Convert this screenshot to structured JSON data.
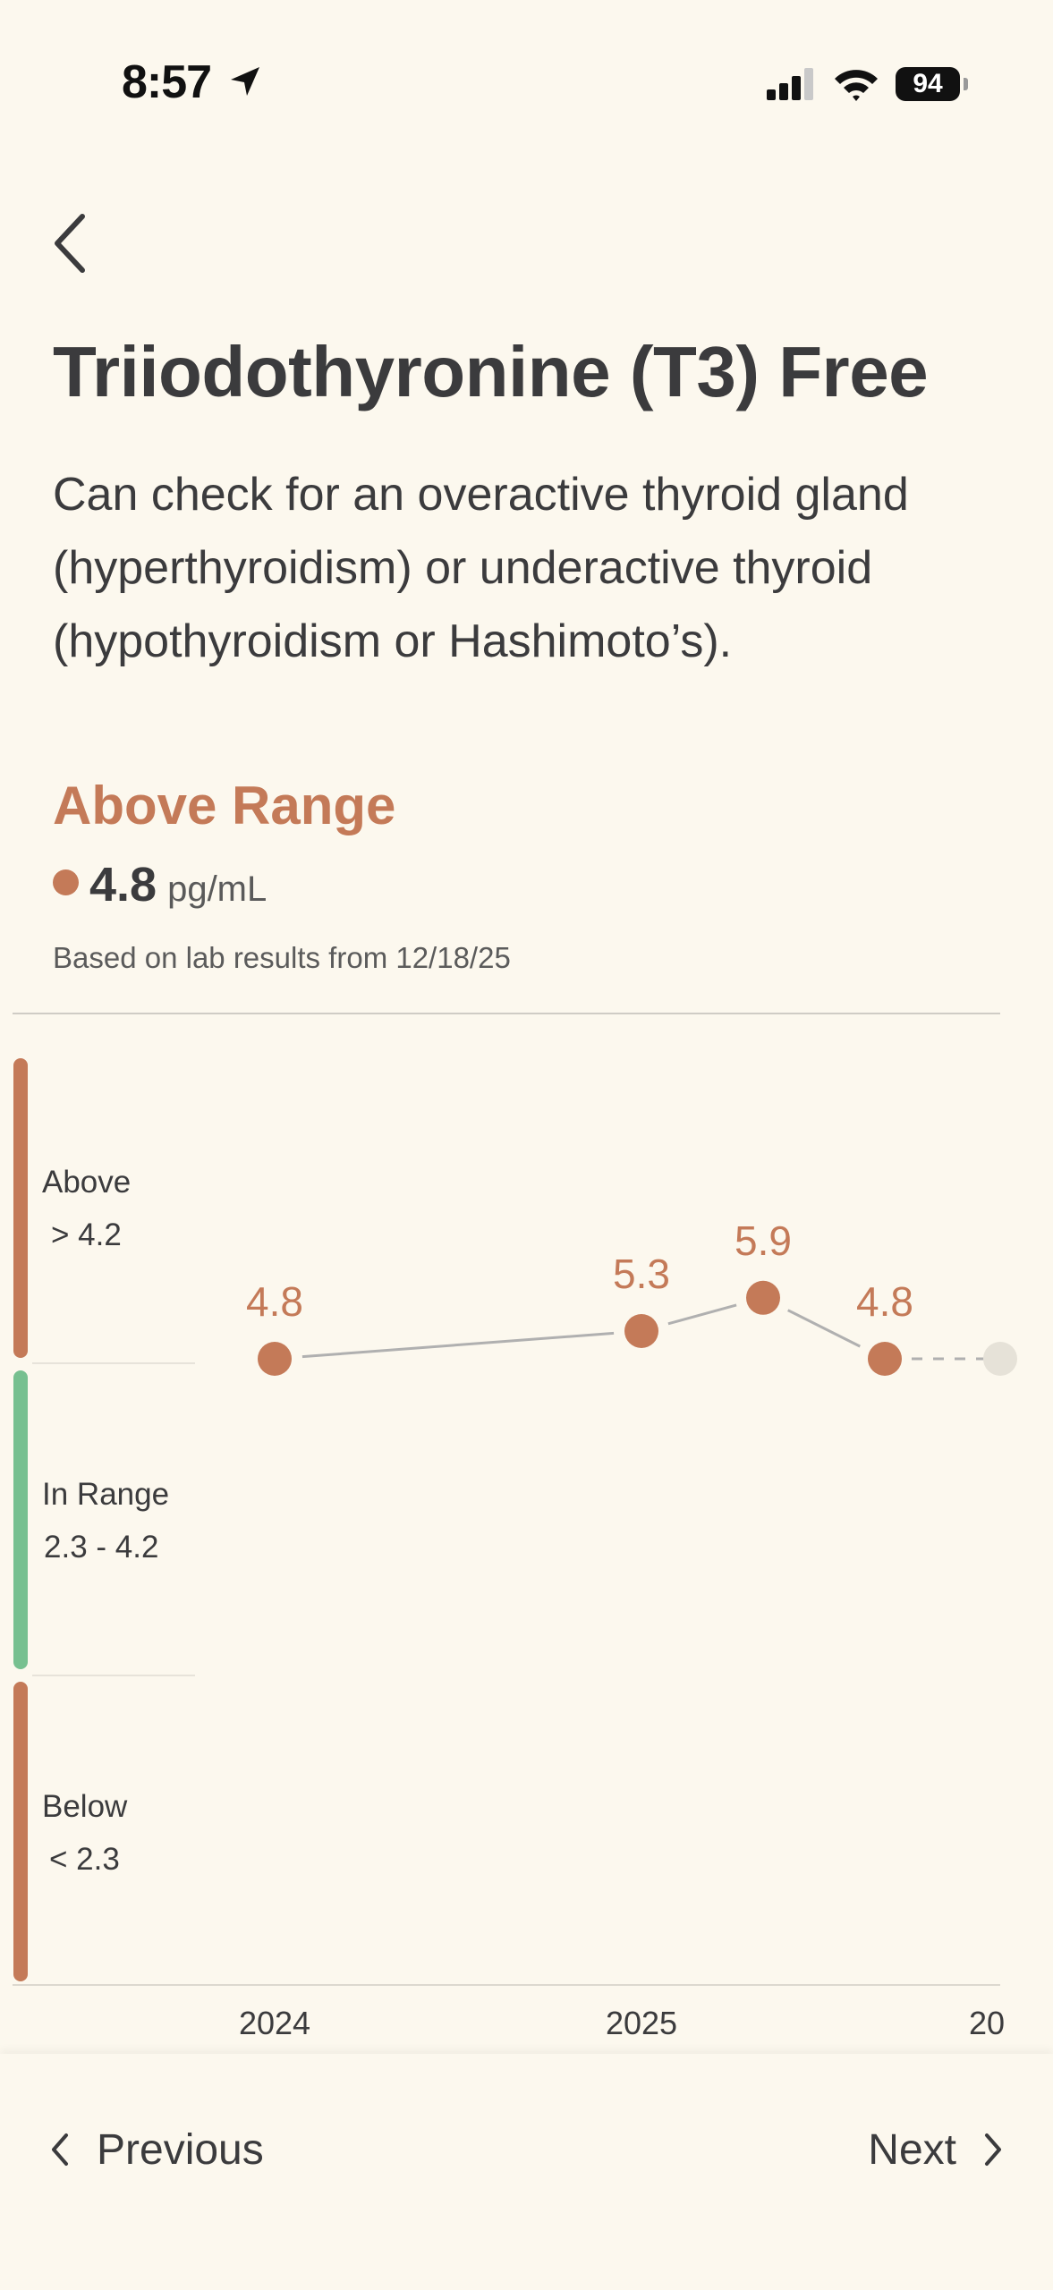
{
  "status_bar": {
    "time": "8:57",
    "battery": "94",
    "icons": [
      "location-arrow-icon",
      "cellular-signal-icon",
      "wifi-icon",
      "battery-icon"
    ]
  },
  "header": {
    "back_icon": "chevron-left-icon",
    "title": "Triiodothyronine (T3) Free",
    "description": "Can check for an overactive thyroid gland (hyperthyroidism) or underactive thyroid (hypothyroidism or Hashimoto’s)."
  },
  "result": {
    "status": "Above Range",
    "value": "4.8",
    "unit": "pg/mL",
    "based_on": "Based on lab results from 12/18/25"
  },
  "colors": {
    "above": "#c47a58",
    "in_range": "#77c090",
    "below": "#c47a58",
    "point": "#c47a58",
    "line": "#b0b0b0",
    "background": "#fcf8ee"
  },
  "chart_data": {
    "type": "line",
    "ranges": [
      {
        "name": "Above",
        "label": "> 4.2",
        "color": "#c47a58"
      },
      {
        "name": "In Range",
        "label": "2.3 - 4.2",
        "color": "#77c090"
      },
      {
        "name": "Below",
        "label": "< 2.3",
        "color": "#c47a58"
      }
    ],
    "x_ticks": [
      "2024",
      "2025",
      "20"
    ],
    "points": [
      {
        "value": 4.8,
        "label": "4.8"
      },
      {
        "value": 5.3,
        "label": "5.3"
      },
      {
        "value": 5.9,
        "label": "5.9"
      },
      {
        "value": 4.8,
        "label": "4.8"
      }
    ],
    "grid": false
  },
  "nav": {
    "previous_label": "Previous",
    "next_label": "Next"
  }
}
